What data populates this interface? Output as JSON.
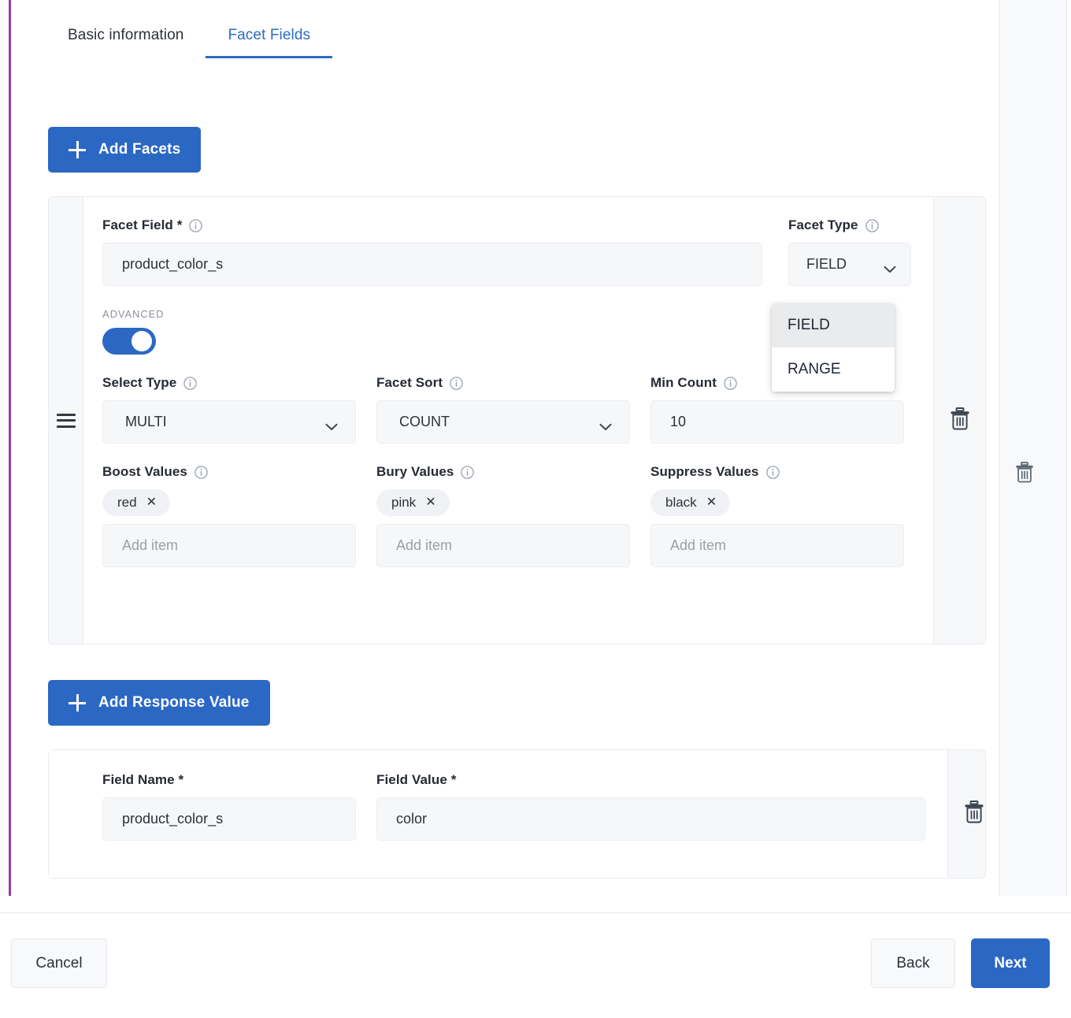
{
  "tabs": [
    {
      "label": "Basic information",
      "active": false
    },
    {
      "label": "Facet Fields",
      "active": true
    }
  ],
  "toolbar": {
    "add_facets_label": "Add Facets",
    "add_response_value_label": "Add Response Value"
  },
  "facet_card": {
    "facet_field": {
      "label": "Facet Field *",
      "value": "product_color_s"
    },
    "facet_type": {
      "label": "Facet Type",
      "value": "FIELD",
      "options": [
        "FIELD",
        "RANGE"
      ],
      "selected_option": "FIELD",
      "open": true
    },
    "advanced_label": "ADVANCED",
    "advanced_enabled": true,
    "select_type": {
      "label": "Select Type",
      "value": "MULTI"
    },
    "facet_sort": {
      "label": "Facet Sort",
      "value": "COUNT"
    },
    "min_count": {
      "label": "Min Count",
      "value": "10"
    },
    "boost_values": {
      "label": "Boost Values",
      "chips": [
        "red"
      ],
      "placeholder": "Add item"
    },
    "bury_values": {
      "label": "Bury Values",
      "chips": [
        "pink"
      ],
      "placeholder": "Add item"
    },
    "suppress_values": {
      "label": "Suppress Values",
      "chips": [
        "black"
      ],
      "placeholder": "Add item"
    }
  },
  "response_card": {
    "field_name": {
      "label": "Field Name *",
      "value": "product_color_s"
    },
    "field_value": {
      "label": "Field Value *",
      "value": "color"
    }
  },
  "footer": {
    "cancel_label": "Cancel",
    "back_label": "Back",
    "next_label": "Next"
  },
  "colors": {
    "accent_blue": "#2b68c4",
    "rail_purple": "#9c3aad",
    "card_bg": "#f7f8fa",
    "input_bg": "#f6f7f9",
    "chip_bg": "#f1f2f5"
  }
}
